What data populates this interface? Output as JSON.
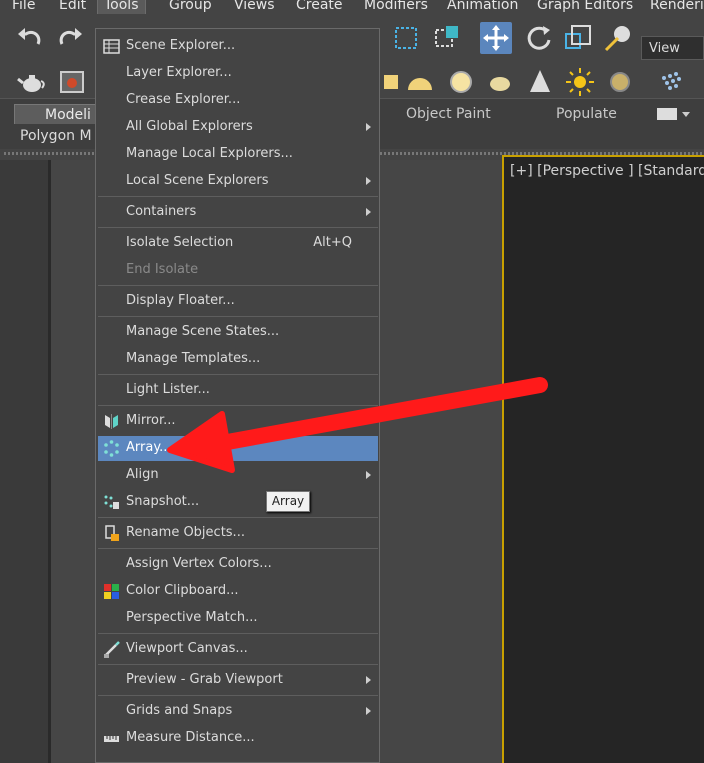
{
  "menubar": {
    "items": [
      "File",
      "Edit",
      "Tools",
      "Group",
      "Views",
      "Create",
      "Modifiers",
      "Animation",
      "Graph Editors",
      "Renderin"
    ]
  },
  "toolbar": {
    "view_combo": "View"
  },
  "ribbon": {
    "tab_modeling": "Modeli",
    "tab_object_paint": "Object Paint",
    "tab_populate": "Populate",
    "sub_label": "Polygon M"
  },
  "viewport": {
    "label": "[+] [Perspective ] [Standard ] ["
  },
  "menu": {
    "items": [
      {
        "label": "Scene Explorer...",
        "icon": "scene-explorer-icon"
      },
      {
        "label": "Layer Explorer..."
      },
      {
        "label": "Crease Explorer..."
      },
      {
        "label": "All Global Explorers",
        "submenu": true
      },
      {
        "label": "Manage Local Explorers..."
      },
      {
        "label": "Local Scene Explorers",
        "submenu": true
      },
      {
        "label": "Containers",
        "submenu": true
      },
      {
        "label": "Isolate Selection",
        "shortcut": "Alt+Q"
      },
      {
        "label": "End Isolate",
        "disabled": true
      },
      {
        "label": "Display Floater..."
      },
      {
        "label": "Manage Scene States..."
      },
      {
        "label": "Manage Templates..."
      },
      {
        "label": "Light Lister..."
      },
      {
        "label": "Mirror...",
        "icon": "mirror-icon"
      },
      {
        "label": "Array...",
        "icon": "array-icon",
        "highlighted": true
      },
      {
        "label": "Align",
        "submenu": true
      },
      {
        "label": "Snapshot...",
        "icon": "snapshot-icon"
      },
      {
        "label": "Rename Objects...",
        "icon": "rename-objects-icon"
      },
      {
        "label": "Assign Vertex Colors..."
      },
      {
        "label": "Color Clipboard...",
        "icon": "color-clipboard-icon"
      },
      {
        "label": "Perspective Match..."
      },
      {
        "label": "Viewport Canvas...",
        "icon": "viewport-canvas-icon"
      },
      {
        "label": "Preview - Grab Viewport",
        "submenu": true
      },
      {
        "label": "Grids and Snaps",
        "submenu": true
      },
      {
        "label": "Measure Distance...",
        "icon": "measure-distance-icon"
      }
    ]
  },
  "tooltip": {
    "text": "Array"
  },
  "colors": {
    "highlight": "#5c87bf",
    "annotation_arrow": "#ff1a1a",
    "viewport_border": "#c8a000"
  }
}
